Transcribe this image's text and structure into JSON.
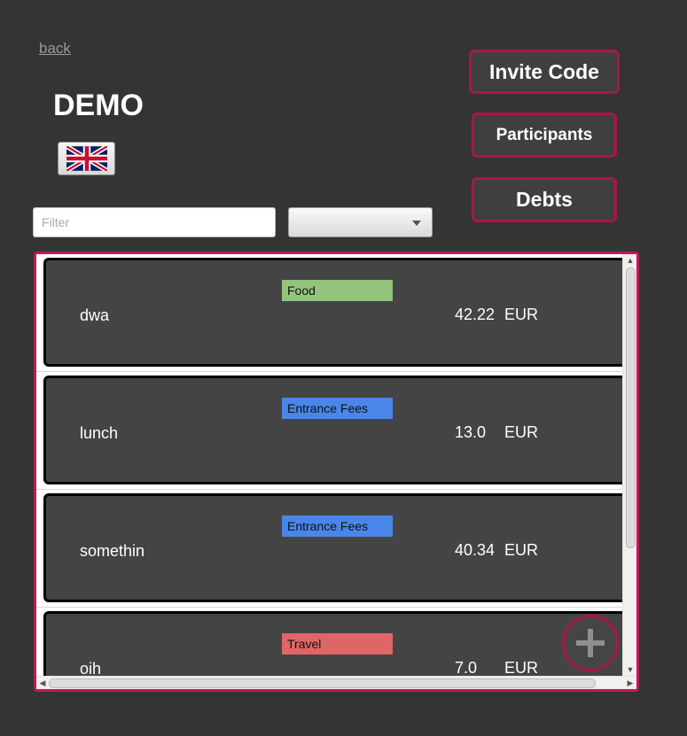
{
  "header": {
    "back_label": "back",
    "event_title": "DEMO",
    "language_flag_icon": "uk-flag-icon"
  },
  "actions": {
    "invite_code_label": "Invite Code",
    "participants_label": "Participants",
    "debts_label": "Debts"
  },
  "filter": {
    "placeholder": "Filter",
    "value": "",
    "tag_select_value": ""
  },
  "expenses": [
    {
      "name": "dwa",
      "tag": "Food",
      "tag_color": "#93c47d",
      "amount": "42.22",
      "currency": "EUR"
    },
    {
      "name": "lunch",
      "tag": "Entrance Fees",
      "tag_color": "#4a86e8",
      "amount": "13.0",
      "currency": "EUR"
    },
    {
      "name": "somethin",
      "tag": "Entrance Fees",
      "tag_color": "#4a86e8",
      "amount": "40.34",
      "currency": "EUR"
    },
    {
      "name": "oih",
      "tag": "Travel",
      "tag_color": "#e06666",
      "amount": "7.0",
      "currency": "EUR"
    }
  ],
  "add_expense_icon": "plus-icon",
  "colors": {
    "background": "#343434",
    "accent": "#c2185b",
    "card": "#444444"
  }
}
